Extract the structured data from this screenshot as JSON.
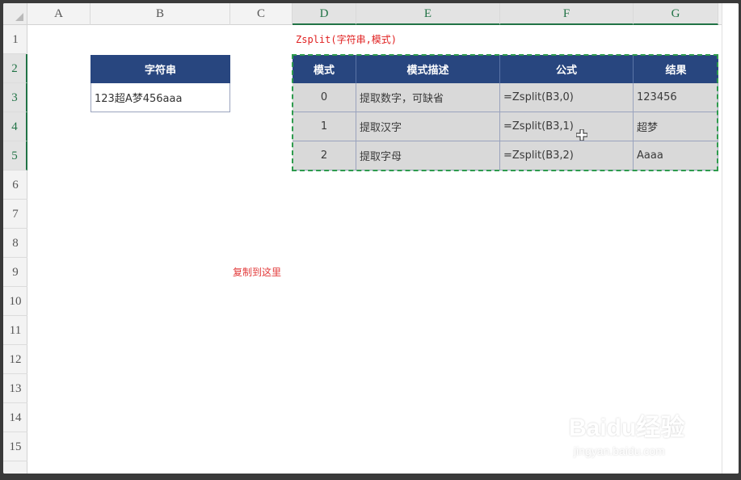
{
  "columns": [
    "A",
    "B",
    "C",
    "D",
    "E",
    "F",
    "G"
  ],
  "rows": [
    "1",
    "2",
    "3",
    "4",
    "5",
    "6",
    "7",
    "8",
    "9",
    "10",
    "11",
    "12",
    "13",
    "14",
    "15"
  ],
  "formula_title": "Zsplit(字符串,模式)",
  "source_table": {
    "header": "字符串",
    "value": "123超A梦456aaa"
  },
  "mode_table": {
    "headers": [
      "模式",
      "模式描述",
      "公式",
      "结果"
    ],
    "rows": [
      {
        "mode": "0",
        "desc": "提取数字，可缺省",
        "formula": "=Zsplit(B3,0)",
        "result": "123456"
      },
      {
        "mode": "1",
        "desc": "提取汉字",
        "formula": "=Zsplit(B3,1)",
        "result": "超梦"
      },
      {
        "mode": "2",
        "desc": "提取字母",
        "formula": "=Zsplit(B3,2)",
        "result": "Aaaa"
      }
    ]
  },
  "paste_hint": "复制到这里",
  "watermark": {
    "brand": "Baidu经验",
    "url": "jingyan.baidu.com"
  },
  "colors": {
    "header_blue": "#28467f",
    "cell_gray": "#d9d9d9",
    "selection_green": "#2e9b4d",
    "hint_red": "#e02020"
  }
}
